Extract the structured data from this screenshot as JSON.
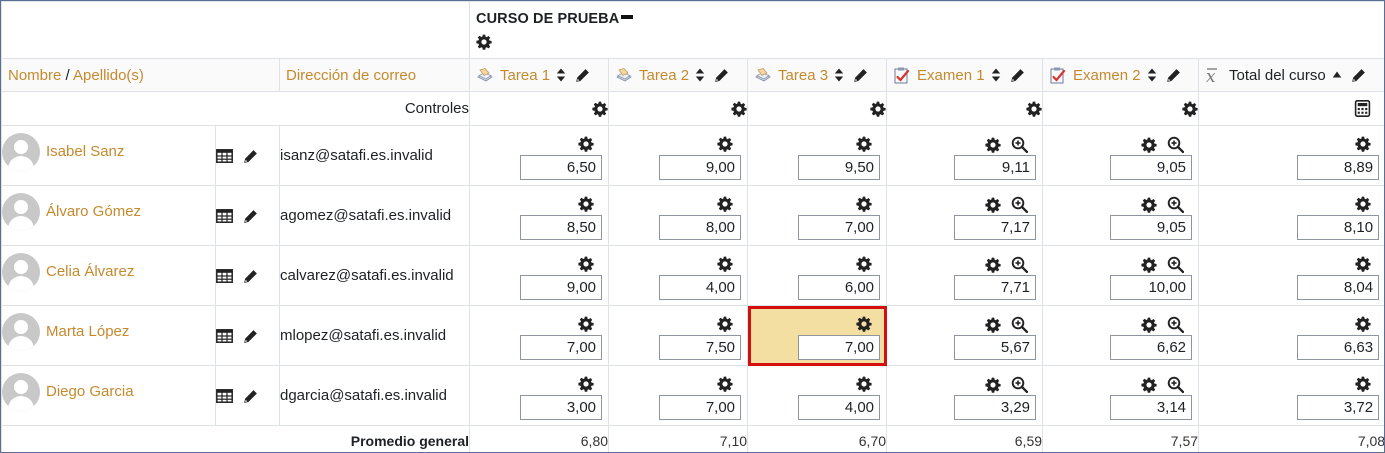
{
  "course": {
    "title": "CURSO DE PRUEBA"
  },
  "header": {
    "first_name": "Nombre",
    "separator": " / ",
    "last_name": "Apellido(s)",
    "email": "Dirección de correo",
    "items": [
      {
        "label": "Tarea 1",
        "type": "assign"
      },
      {
        "label": "Tarea 2",
        "type": "assign"
      },
      {
        "label": "Tarea 3",
        "type": "assign"
      },
      {
        "label": "Examen 1",
        "type": "quiz"
      },
      {
        "label": "Examen 2",
        "type": "quiz"
      },
      {
        "label": "Total del curso",
        "type": "total"
      }
    ]
  },
  "controls": {
    "label": "Controles"
  },
  "students": [
    {
      "name": "Isabel Sanz",
      "email": "isanz@satafi.es.invalid",
      "grades": [
        "6,50",
        "9,00",
        "9,50",
        "9,11",
        "9,05",
        "8,89"
      ]
    },
    {
      "name": "Álvaro Gómez",
      "email": "agomez@satafi.es.invalid",
      "grades": [
        "8,50",
        "8,00",
        "7,00",
        "7,17",
        "9,05",
        "8,10"
      ]
    },
    {
      "name": "Celia Álvarez",
      "email": "calvarez@satafi.es.invalid",
      "grades": [
        "9,00",
        "4,00",
        "6,00",
        "7,71",
        "10,00",
        "8,04"
      ]
    },
    {
      "name": "Marta López",
      "email": "mlopez@satafi.es.invalid",
      "grades": [
        "7,00",
        "7,50",
        "7,00",
        "5,67",
        "6,62",
        "6,63"
      ]
    },
    {
      "name": "Diego Garcia",
      "email": "dgarcia@satafi.es.invalid",
      "grades": [
        "3,00",
        "7,00",
        "4,00",
        "3,29",
        "3,14",
        "3,72"
      ]
    }
  ],
  "average": {
    "label": "Promedio general",
    "values": [
      "6,80",
      "7,10",
      "6,70",
      "6,59",
      "7,57",
      "7,08"
    ]
  },
  "highlight": {
    "student": 3,
    "item": 2
  },
  "colors": {
    "link": "#c58a2e",
    "highlight_bg": "#f4dfa3",
    "highlight_border": "#d40f0f",
    "border": "#dee2e6"
  }
}
